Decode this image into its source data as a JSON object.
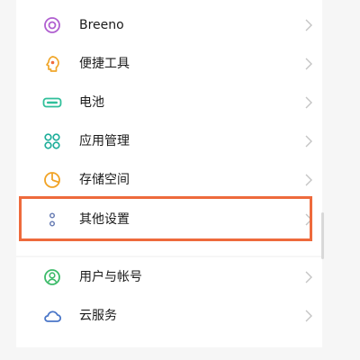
{
  "settings": {
    "items": [
      {
        "label": "Breeno",
        "icon": "breeno-icon",
        "color": "#b05fd0"
      },
      {
        "label": "便捷工具",
        "icon": "tools-icon",
        "color": "#f0a62a"
      },
      {
        "label": "电池",
        "icon": "battery-icon",
        "color": "#2fbf9a"
      },
      {
        "label": "应用管理",
        "icon": "apps-grid-icon",
        "color": "#1fae9a"
      },
      {
        "label": "存储空间",
        "icon": "storage-icon",
        "color": "#f1a326"
      },
      {
        "label": "其他设置",
        "icon": "more-dots-icon",
        "color": "#6b7fb5"
      },
      {
        "label": "用户与帐号",
        "icon": "user-account-icon",
        "color": "#3dbb6a"
      },
      {
        "label": "云服务",
        "icon": "cloud-icon",
        "color": "#4a76c8"
      }
    ]
  },
  "highlight_color": "#ee6a3c"
}
